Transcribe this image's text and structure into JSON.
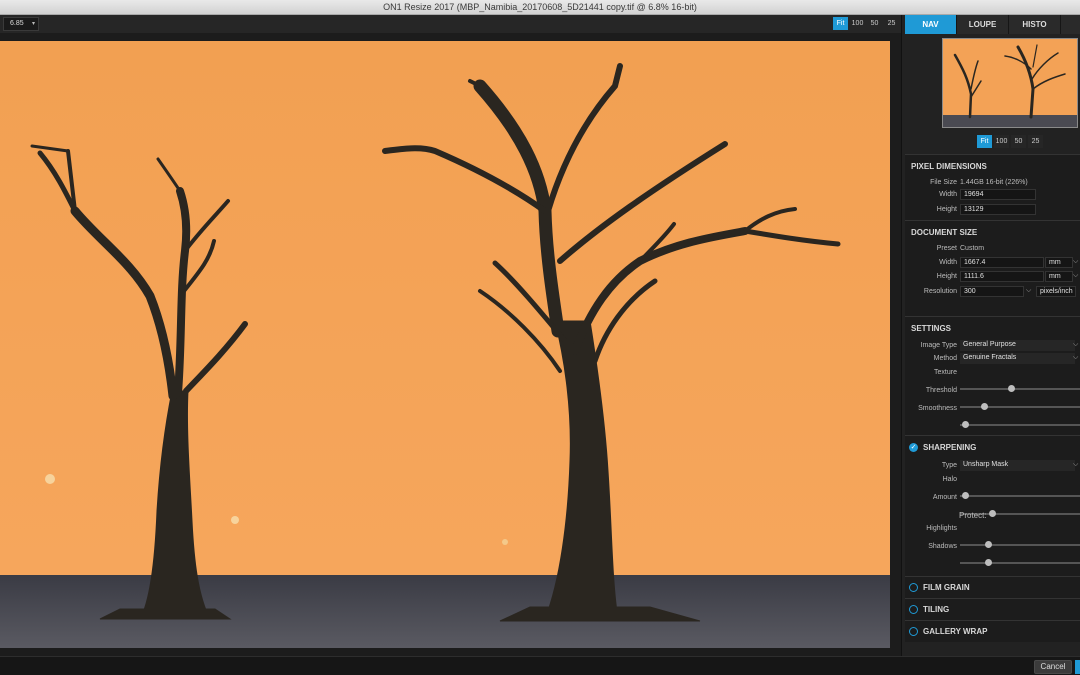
{
  "window": {
    "title": "ON1 Resize 2017 (MBP_Namibia_20170608_5D21441 copy.tif @ 6.8% 16-bit)"
  },
  "toolbar": {
    "zoom_value": "6.85",
    "zoom_caret": "▾",
    "zoom_buttons": [
      "Fit",
      "100",
      "50",
      "25"
    ]
  },
  "panel": {
    "tabs": [
      "NAV",
      "LOUPE",
      "HISTO"
    ],
    "nav_zoom_buttons": [
      "Fit",
      "100",
      "50",
      "25"
    ],
    "pixel_dimensions": {
      "title": "PIXEL DIMENSIONS",
      "file_size_label": "File Size",
      "file_size_value": "1.44GB 16-bit (226%)",
      "width_label": "Width",
      "width_value": "19694",
      "height_label": "Height",
      "height_value": "13129"
    },
    "document_size": {
      "title": "DOCUMENT SIZE",
      "preset_label": "Preset",
      "preset_value": "Custom",
      "width_label": "Width",
      "width_value": "1667.4",
      "width_unit": "mm",
      "height_label": "Height",
      "height_value": "1111.6",
      "height_unit": "mm",
      "resolution_label": "Resolution",
      "resolution_value": "300",
      "resolution_unit": "pixels/inch"
    },
    "settings": {
      "title": "SETTINGS",
      "image_type_label": "Image Type",
      "image_type_value": "General Purpose",
      "method_label": "Method",
      "method_value": "Genuine Fractals",
      "texture_label": "Texture",
      "texture_level": 0.42,
      "threshold_label": "Threshold",
      "threshold_level": 0.18,
      "smoothness_label": "Smoothness",
      "smoothness_level": 0.02
    },
    "sharpening": {
      "title": "SHARPENING",
      "checkmark": "✓",
      "type_label": "Type",
      "type_value": "Unsharp Mask",
      "halo_label": "Halo",
      "halo_level": 0.02,
      "amount_label": "Amount",
      "amount_level": 0.25,
      "protect_label": "Protect:",
      "highlights_label": "Highlights",
      "highlights_level": 0.22,
      "shadows_label": "Shadows",
      "shadows_level": 0.22
    },
    "film_grain": {
      "title": "FILM GRAIN"
    },
    "tiling": {
      "title": "TILING"
    },
    "gallery_wrap": {
      "title": "GALLERY WRAP"
    }
  },
  "footer": {
    "cancel_label": "Cancel"
  },
  "colors": {
    "accent": "#1f9ad6",
    "sky": "#f3a256",
    "ground": "#4a4a52"
  }
}
